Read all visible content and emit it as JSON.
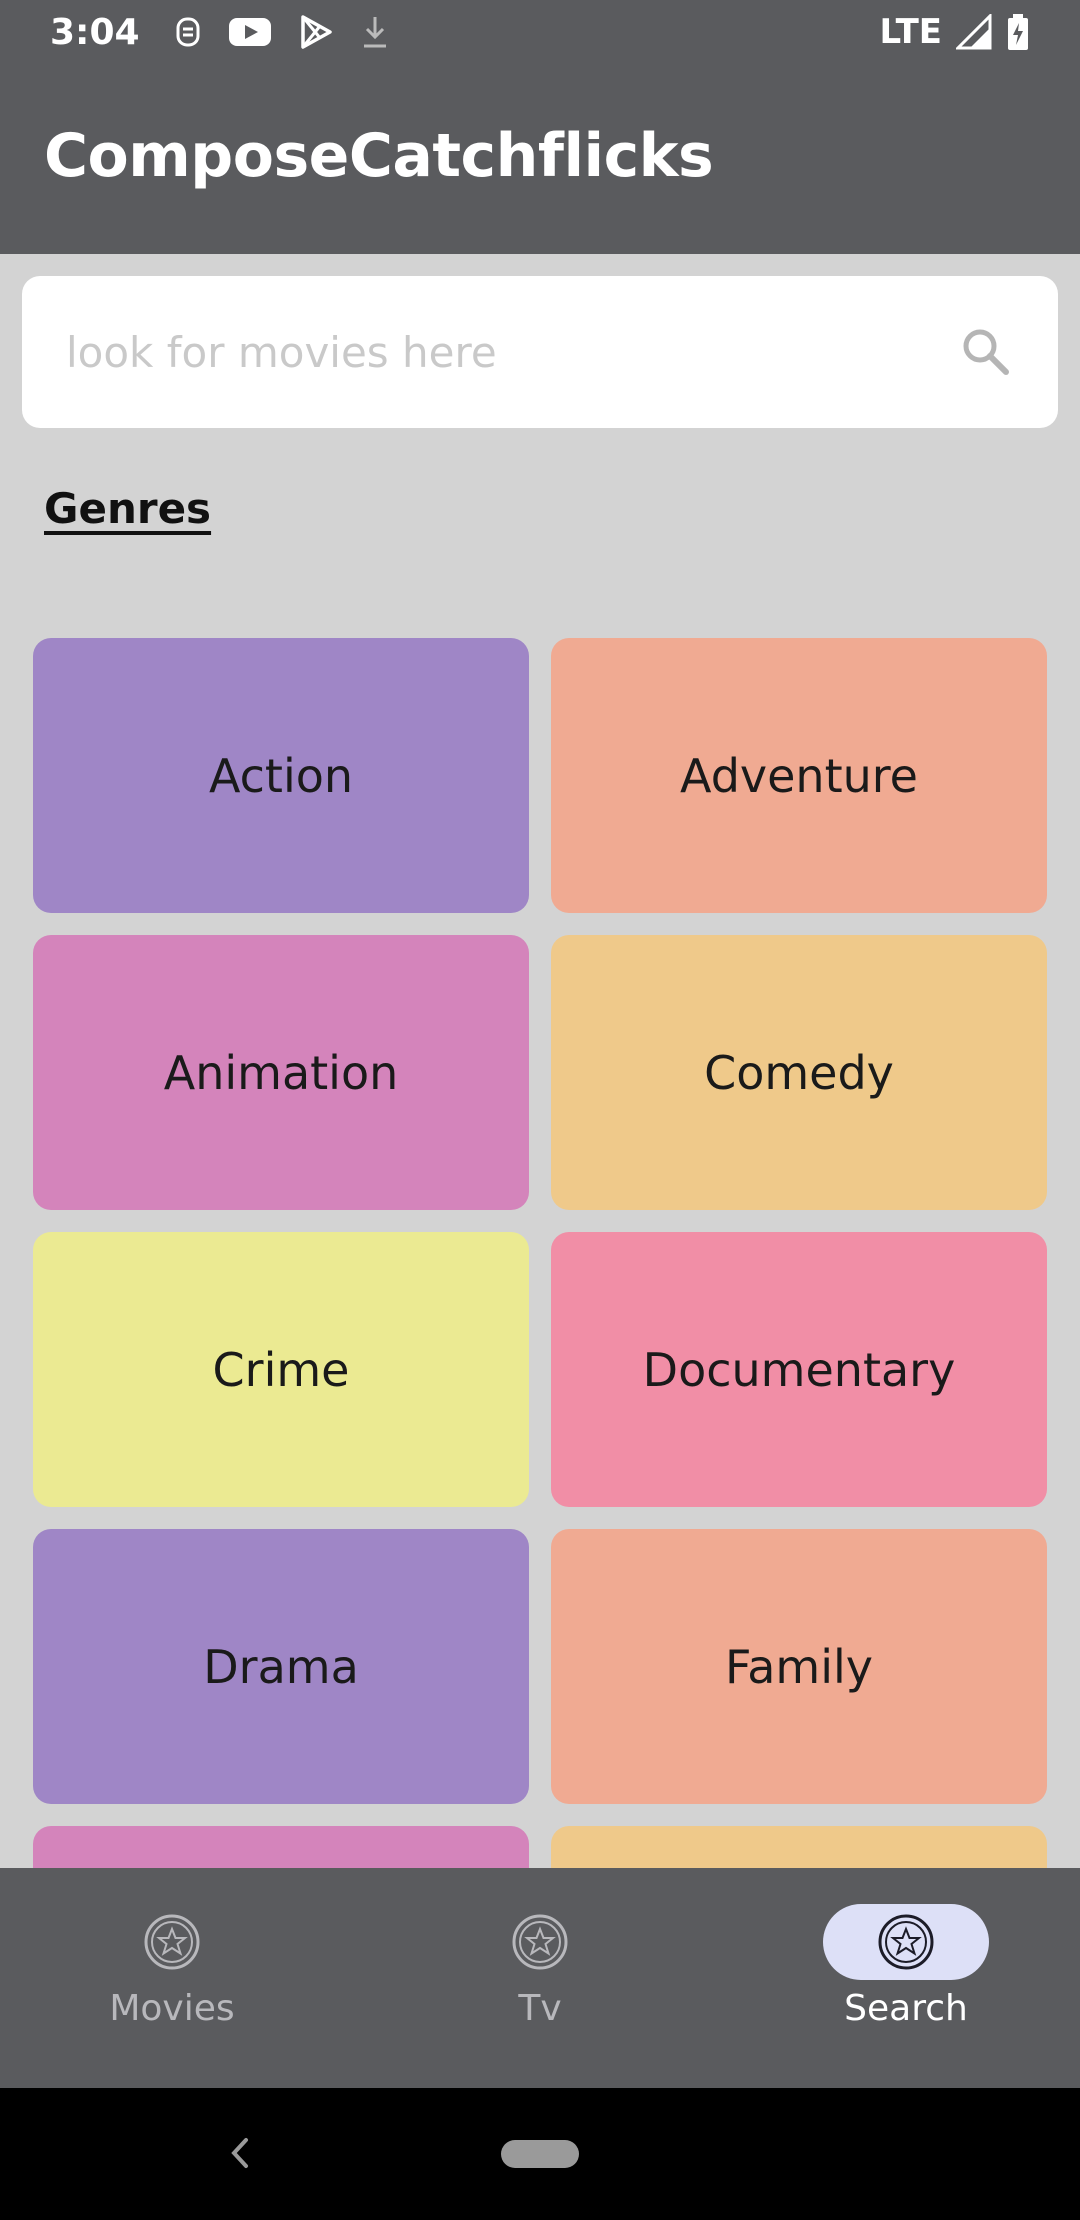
{
  "status_bar": {
    "time": "3:04",
    "network": "LTE",
    "icons": [
      "notification-icon",
      "youtube-icon",
      "play-store-icon",
      "download-icon",
      "signal-icon",
      "battery-icon"
    ]
  },
  "app_bar": {
    "title": "ComposeCatchflicks"
  },
  "search": {
    "placeholder": "look for movies here",
    "icon": "search-icon"
  },
  "genres": {
    "heading": "Genres",
    "items": [
      {
        "label": "Action",
        "color": "#9f86c6"
      },
      {
        "label": "Adventure",
        "color": "#f0aa92"
      },
      {
        "label": "Animation",
        "color": "#d484bb"
      },
      {
        "label": "Comedy",
        "color": "#efc98a"
      },
      {
        "label": "Crime",
        "color": "#ebea92"
      },
      {
        "label": "Documentary",
        "color": "#f18ea6"
      },
      {
        "label": "Drama",
        "color": "#9f86c6"
      },
      {
        "label": "Family",
        "color": "#f0aa92"
      },
      {
        "label": "",
        "color": "#d484bb"
      },
      {
        "label": "",
        "color": "#efc98a"
      }
    ]
  },
  "bottom_nav": {
    "items": [
      {
        "label": "Movies",
        "icon": "star-circle-icon",
        "active": false
      },
      {
        "label": "Tv",
        "icon": "star-circle-icon",
        "active": false
      },
      {
        "label": "Search",
        "icon": "star-circle-icon",
        "active": true
      }
    ]
  },
  "colors": {
    "bar_background": "#5a5b5e",
    "page_background": "#d3d3d3",
    "active_pill": "#dde0f7",
    "inactive_nav_text": "#b8b8bc",
    "active_nav_text": "#ffffff"
  }
}
